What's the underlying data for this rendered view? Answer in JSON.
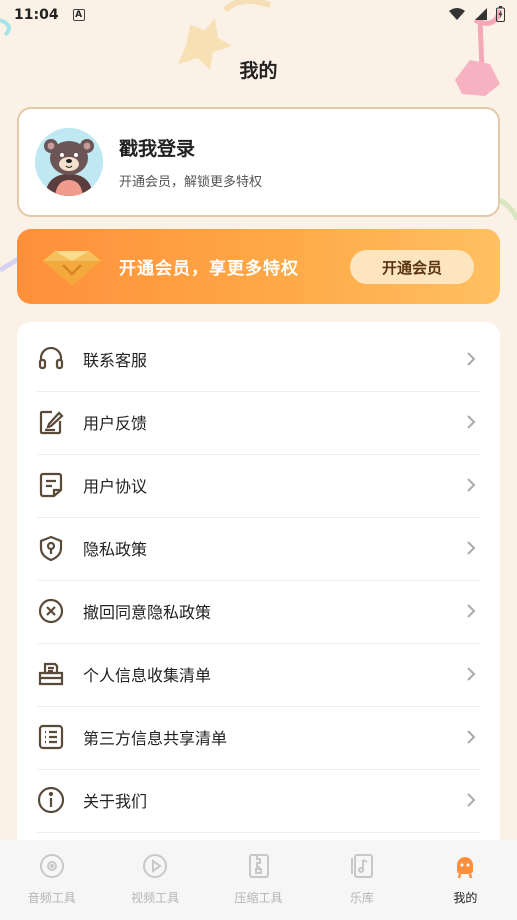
{
  "status_bar": {
    "time": "11:04",
    "a_badge": "A"
  },
  "page": {
    "title": "我的"
  },
  "profile": {
    "name": "戳我登录",
    "subtitle": "开通会员，解锁更多特权"
  },
  "vip_banner": {
    "text": "开通会员，享更多特权",
    "button_label": "开通会员"
  },
  "menu": {
    "items": [
      {
        "label": "联系客服",
        "icon": "headset-icon"
      },
      {
        "label": "用户反馈",
        "icon": "feedback-edit-icon"
      },
      {
        "label": "用户协议",
        "icon": "agreement-document-icon"
      },
      {
        "label": "隐私政策",
        "icon": "privacy-shield-icon"
      },
      {
        "label": "撤回同意隐私政策",
        "icon": "revoke-x-circle-icon"
      },
      {
        "label": "个人信息收集清单",
        "icon": "personal-info-collection-icon"
      },
      {
        "label": "第三方信息共享清单",
        "icon": "third-party-list-icon"
      },
      {
        "label": "关于我们",
        "icon": "info-circle-icon"
      }
    ]
  },
  "bottom_nav": {
    "items": [
      {
        "label": "音频工具",
        "icon": "audio-tool-icon",
        "active": false
      },
      {
        "label": "视频工具",
        "icon": "video-tool-icon",
        "active": false
      },
      {
        "label": "压缩工具",
        "icon": "compress-tool-icon",
        "active": false
      },
      {
        "label": "乐库",
        "icon": "music-library-icon",
        "active": false
      },
      {
        "label": "我的",
        "icon": "mine-icon",
        "active": true
      }
    ]
  },
  "colors": {
    "background": "#fbf1e7",
    "vip_gradient_start": "#ff8f3a",
    "vip_gradient_end": "#ffc062",
    "active_nav": "#ff8f3a",
    "icon_stroke": "#5a4a3a"
  }
}
